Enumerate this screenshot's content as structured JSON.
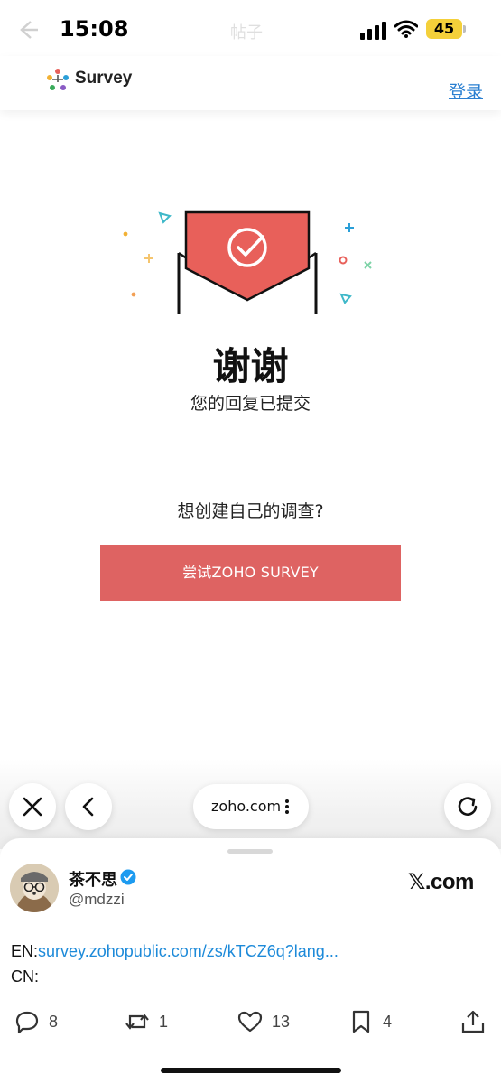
{
  "status_bar": {
    "time": "15:08",
    "ghost_title": "帖子",
    "battery": "45"
  },
  "survey_header": {
    "brand": "Survey",
    "login": "登录"
  },
  "thanks": {
    "title": "谢谢",
    "subtitle": "您的回复已提交"
  },
  "cta": {
    "question": "想创建自己的调查?",
    "button": "尝试ZOHO SURVEY"
  },
  "browser": {
    "url": "zoho.com"
  },
  "tweet": {
    "author": "茶不思",
    "handle": "@mdzzi",
    "source": "𝕏.com",
    "line1_prefix": "EN:",
    "line1_link": "survey.zohopublic.com/zs/kTCZ6q?lang...",
    "line2": "CN:",
    "actions": {
      "replies": "8",
      "retweets": "1",
      "likes": "13",
      "bookmarks": "4"
    }
  },
  "colors": {
    "accent_red": "#de6362",
    "envelope_red": "#e8605a",
    "link_blue": "#1d8ad9",
    "verified_blue": "#1d9bf0",
    "battery_yellow": "#f4d03a"
  },
  "icons": [
    "back-icon",
    "signal-icon",
    "wifi-icon",
    "battery-icon",
    "survey-logo-icon",
    "envelope-check-icon",
    "close-icon",
    "chevron-left-icon",
    "more-vertical-icon",
    "reload-icon",
    "verified-badge-icon",
    "reply-icon",
    "retweet-icon",
    "like-icon",
    "bookmark-icon",
    "share-icon"
  ]
}
